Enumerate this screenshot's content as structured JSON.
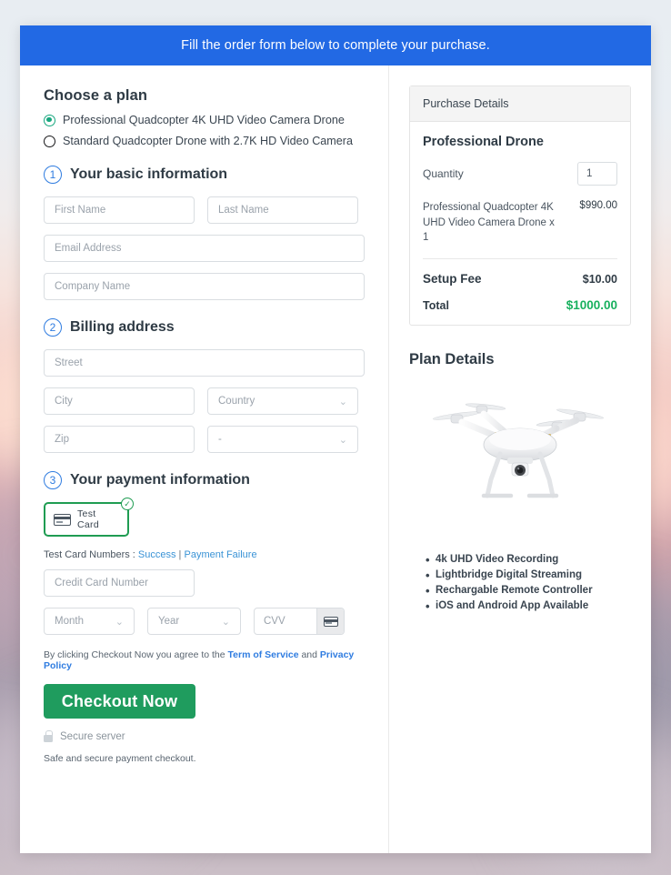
{
  "banner": {
    "text": "Fill the order form below to complete your purchase."
  },
  "plan": {
    "title": "Choose a plan",
    "options": [
      {
        "label": "Professional Quadcopter 4K UHD Video Camera Drone",
        "selected": true
      },
      {
        "label": "Standard Quadcopter Drone with 2.7K HD Video Camera",
        "selected": false
      }
    ]
  },
  "steps": {
    "basic": {
      "num": "1",
      "title": "Your basic information"
    },
    "billing": {
      "num": "2",
      "title": "Billing address"
    },
    "payment": {
      "num": "3",
      "title": "Your payment information"
    }
  },
  "fields": {
    "first_name": "First Name",
    "last_name": "Last Name",
    "email": "Email Address",
    "company": "Company Name",
    "street": "Street",
    "city": "City",
    "country": "Country",
    "zip": "Zip",
    "state": "-",
    "credit_card": "Credit Card Number",
    "month": "Month",
    "year": "Year",
    "cvv": "CVV"
  },
  "payment": {
    "method_label": "Test Card",
    "badge": "✓",
    "test_numbers_prefix": "Test Card Numbers : ",
    "link_success": "Success",
    "link_divider": " | ",
    "link_failure": "Payment Failure"
  },
  "footer": {
    "terms_prefix": "By clicking Checkout Now you agree to the ",
    "terms_link": "Term of Service",
    "terms_and": " and ",
    "privacy_link": "Privacy Policy",
    "checkout_label": "Checkout Now",
    "secure_server": "Secure server",
    "safe_text": "Safe and secure payment checkout."
  },
  "purchase": {
    "panel_title": "Purchase Details",
    "product_title": "Professional Drone",
    "quantity_label": "Quantity",
    "quantity_value": "1",
    "line_item_desc": "Professional Quadcopter 4K UHD Video Camera Drone x 1",
    "line_item_amount": "$990.00",
    "setup_fee_label": "Setup Fee",
    "setup_fee_amount": "$10.00",
    "total_label": "Total",
    "total_amount": "$1000.00"
  },
  "plan_details": {
    "title": "Plan Details",
    "features": [
      "4k UHD Video Recording",
      "Lightbridge Digital Streaming",
      "Rechargable Remote Controller",
      "iOS and Android App Available"
    ]
  },
  "colors": {
    "banner_blue": "#2269e4",
    "accent_green": "#1f9c5e",
    "total_green": "#18b05e",
    "step_blue": "#2f7ce0",
    "radio_green": "#17a77e",
    "link_blue": "#3a93d6"
  }
}
